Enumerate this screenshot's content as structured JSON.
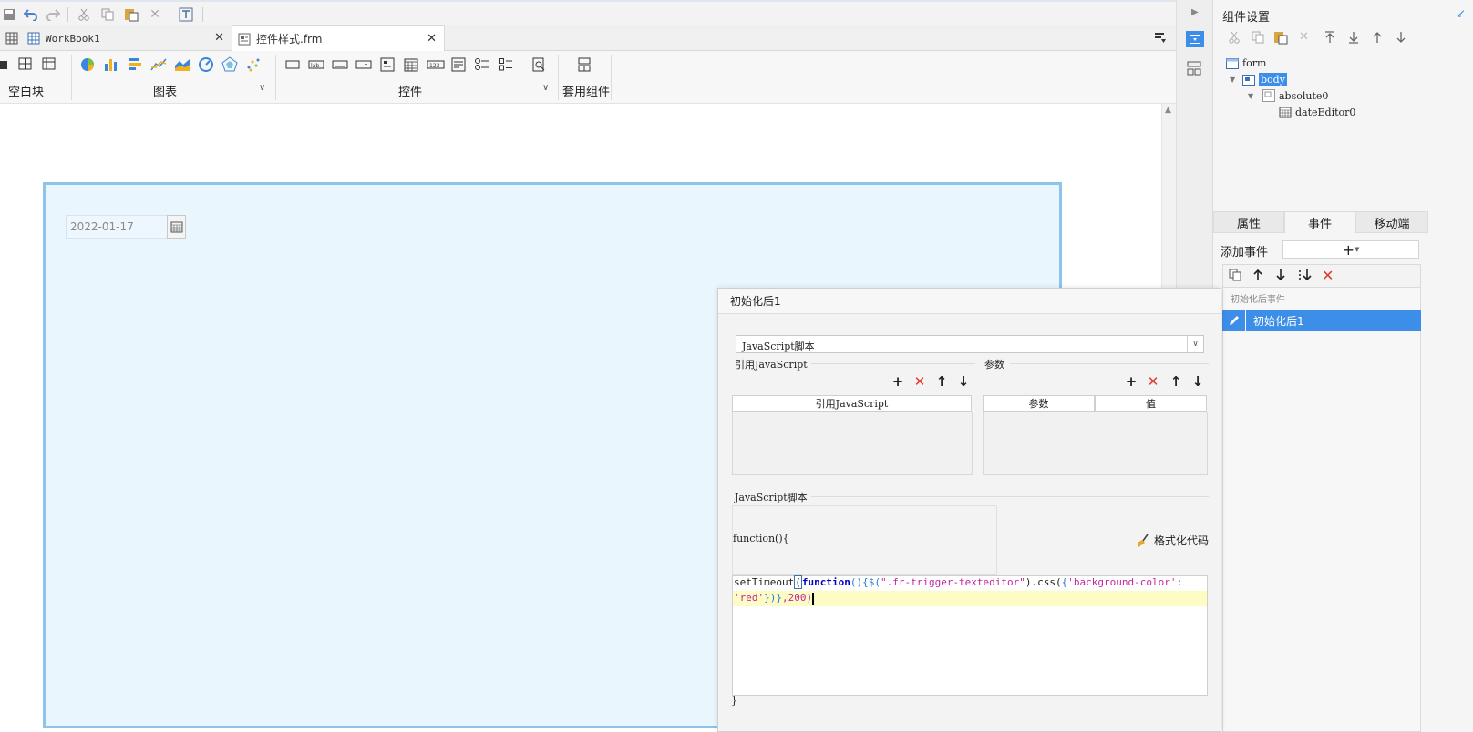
{
  "tabs": [
    {
      "label": "WorkBook1"
    },
    {
      "label": "控件样式.frm"
    }
  ],
  "ribbon": {
    "groups": [
      {
        "label": "空白块"
      },
      {
        "label": "图表"
      },
      {
        "label": "控件"
      },
      {
        "label": "套用组件"
      }
    ]
  },
  "canvas": {
    "date_value": "2022-01-17"
  },
  "right_panel": {
    "title": "组件设置",
    "tree": [
      {
        "label": "form"
      },
      {
        "label": "body"
      },
      {
        "label": "absolute0"
      },
      {
        "label": "dateEditor0"
      }
    ],
    "tabs": [
      {
        "label": "属性"
      },
      {
        "label": "事件"
      },
      {
        "label": "移动端"
      }
    ],
    "add_event_label": "添加事件",
    "event_group": "初始化后事件",
    "selected_event": "初始化后1"
  },
  "dialog": {
    "title": "初始化后1",
    "type_select": "JavaScript脚本",
    "ref_js_label": "引用JavaScript",
    "params_label": "参数",
    "ref_js_col": "引用JavaScript",
    "param_col": "参数",
    "value_col": "值",
    "script_label": "JavaScript脚本",
    "func_open": "function(){",
    "format_code": "格式化代码",
    "code_line1_a": "setTimeout",
    "code_line1_b": "(",
    "code_line1_c": "function",
    "code_line1_d": "(){$(",
    "code_line1_e": "\".fr-trigger-texteditor\"",
    "code_line1_f": ").css(",
    "code_line1_g": "{",
    "code_line1_h": "'background-color'",
    "code_line1_i": ":",
    "code_line2_a": "'red'",
    "code_line2_b": "})}",
    "code_line2_c": ",200)",
    "func_close": "}"
  },
  "colors": {
    "accent": "#3d8ee8",
    "canvas_bg": "#eaf6fd",
    "canvas_border": "#8ec3ec",
    "highlight_line": "#fdfcc4",
    "delete_red": "#e03a2f"
  }
}
